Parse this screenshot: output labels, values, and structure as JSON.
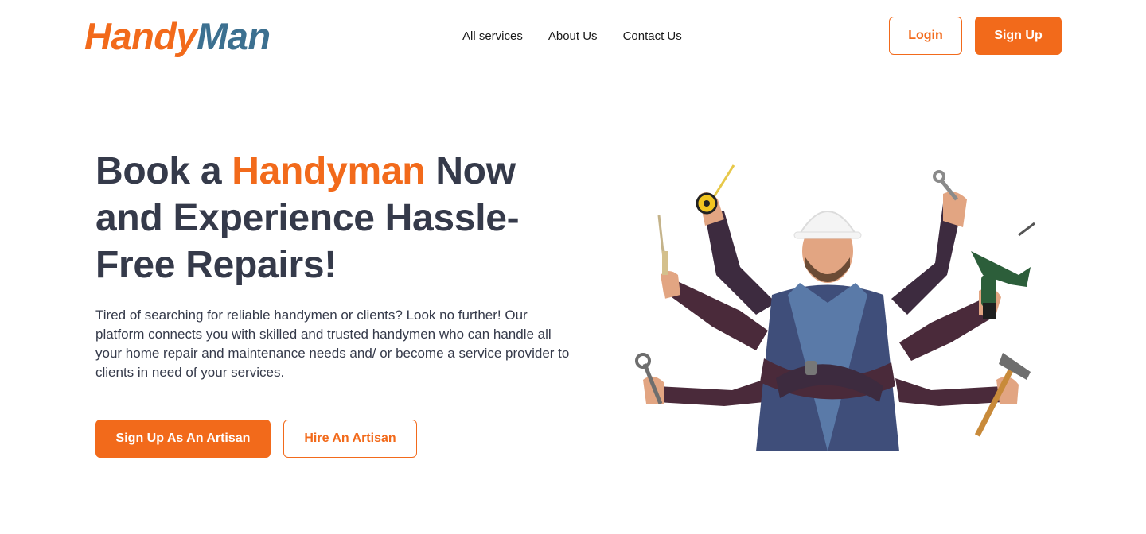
{
  "brand": {
    "logo_part1": "Handy",
    "logo_part2": "Man",
    "accent": "#f26a1b",
    "secondary": "#3c7090",
    "text_dark": "#353a4a"
  },
  "nav": {
    "items": [
      {
        "label": "All services"
      },
      {
        "label": "About Us"
      },
      {
        "label": "Contact Us"
      }
    ],
    "login_label": "Login",
    "signup_label": "Sign Up"
  },
  "hero": {
    "headline_pre": "Book a ",
    "headline_highlight": "Handyman",
    "headline_post": " Now and Experience Hassle-Free Repairs!",
    "description": "Tired of searching for reliable handymen or clients? Look no further! Our platform connects you with skilled and trusted handymen who can handle all your home repair and maintenance needs and/ or become a service provider to clients in need of your services.",
    "cta_primary": "Sign Up As An Artisan",
    "cta_secondary": "Hire An Artisan"
  },
  "illustration": {
    "icon": "handyman-multi-arm-illustration",
    "tools": [
      "tape-measure-icon",
      "wrench-icon",
      "drill-icon",
      "screwdriver-icon",
      "hammer-icon"
    ]
  }
}
